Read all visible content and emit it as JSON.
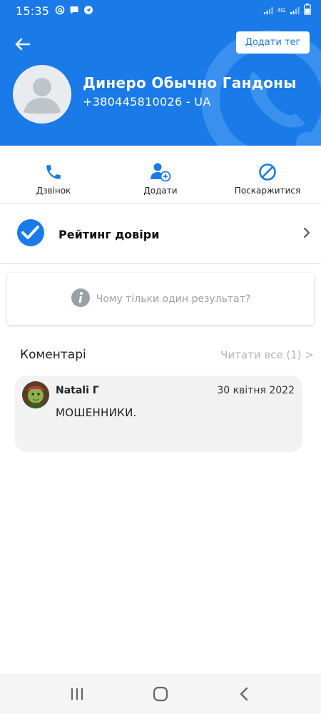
{
  "status_bar": {
    "time": "15:35",
    "network": "4G",
    "icons": [
      "at-sign-icon",
      "message-icon",
      "navigation-icon",
      "signal-icon",
      "battery-icon"
    ]
  },
  "header": {
    "add_tag_label": "Додати тег",
    "contact_name": "Динеро Обычно Гандоны",
    "contact_phone": "+380445810026 - UA"
  },
  "actions": [
    {
      "label": "Дзвінок",
      "icon": "phone-icon"
    },
    {
      "label": "Додати",
      "icon": "add-contact-icon"
    },
    {
      "label": "Поскаржитися",
      "icon": "block-icon"
    }
  ],
  "trust": {
    "label": "Рейтинг довіри",
    "icon": "check-badge-icon"
  },
  "why_card": {
    "text": "Чому тільки один результат?",
    "icon": "info-icon"
  },
  "comments": {
    "title": "Коментарі",
    "read_all": "Читати все (1) >",
    "items": [
      {
        "author": "Natali Г",
        "date": "30 квітня 2022",
        "text": "МОШЕННИКИ."
      }
    ]
  },
  "nav": {
    "icons": [
      "recent-apps-icon",
      "home-icon",
      "back-icon"
    ]
  },
  "colors": {
    "primary": "#1a7ae8",
    "text_muted": "#9aa0a6",
    "card_bg": "#f2f2f2"
  }
}
